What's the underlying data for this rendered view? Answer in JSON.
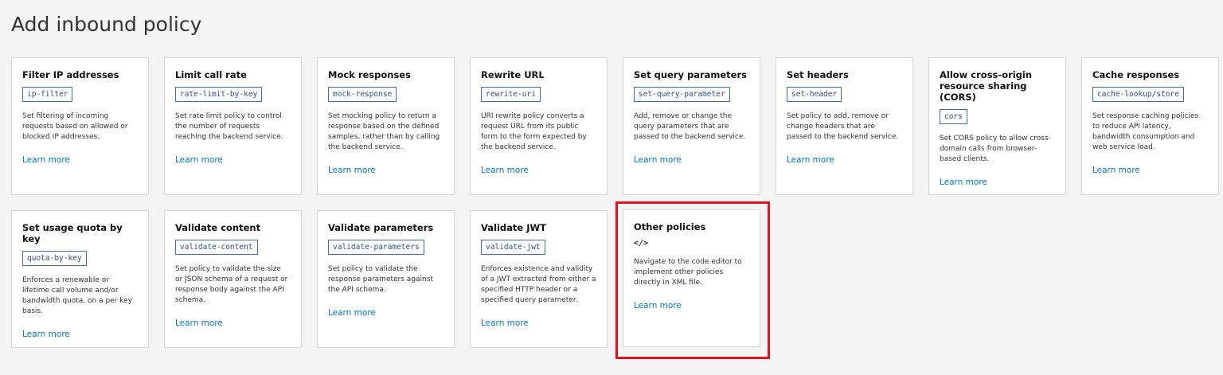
{
  "page_title": "Add inbound policy",
  "cards": [
    {
      "title": "Filter IP addresses",
      "code": "ip-filter",
      "desc": "Set filtering of incoming requests based on allowed or blocked IP addresses.",
      "link": "Learn more"
    },
    {
      "title": "Limit call rate",
      "code": "rate-limit-by-key",
      "desc": "Set rate limit policy to control the number of requests reaching the backend service.",
      "link": "Learn more"
    },
    {
      "title": "Mock responses",
      "code": "mock-response",
      "desc": "Set mocking policy to return a response based on the defined samples, rather than by calling the backend service.",
      "link": "Learn more"
    },
    {
      "title": "Rewrite URL",
      "code": "rewrite-uri",
      "desc": "URI rewrite policy converts a request URL from its public form to the form expected by the backend service.",
      "link": "Learn more"
    },
    {
      "title": "Set query parameters",
      "code": "set-query-parameter",
      "desc": "Add, remove or change the query parameters that are passed to the backend service.",
      "link": "Learn more"
    },
    {
      "title": "Set headers",
      "code": "set-header",
      "desc": "Set policy to add, remove or change headers that are passed to the backend service.",
      "link": "Learn more"
    },
    {
      "title": "Allow cross-origin resource sharing (CORS)",
      "code": "cors",
      "desc": "Set CORS policy to allow cross-domain calls from browser-based clients.",
      "link": "Learn more"
    },
    {
      "title": "Cache responses",
      "code": "cache-lookup/store",
      "desc": "Set response caching policies to reduce API latency, bandwidth consumption and web service load.",
      "link": "Learn more"
    },
    {
      "title": "Set usage quota by key",
      "code": "quota-by-key",
      "desc": "Enforces a renewable or lifetime call volume and/or bandwidth quota, on a per key basis.",
      "link": "Learn more"
    },
    {
      "title": "Validate content",
      "code": "validate-content",
      "desc": "Set policy to validate the size or JSON schema of a request or response body against the API schema.",
      "link": "Learn more"
    },
    {
      "title": "Validate parameters",
      "code": "validate-parameters",
      "desc": "Set policy to validate the response parameters against the API schema.",
      "link": "Learn more"
    },
    {
      "title": "Validate JWT",
      "code": "validate-jwt",
      "desc": "Enforces existence and validity of a JWT extracted from either a specified HTTP header or a specified query parameter.",
      "link": "Learn more"
    },
    {
      "title": "Other policies",
      "icon": "</>",
      "desc": "Navigate to the code editor to implement other policies directly in XML file.",
      "link": "Learn more"
    }
  ],
  "highlight_color": "#e81123"
}
